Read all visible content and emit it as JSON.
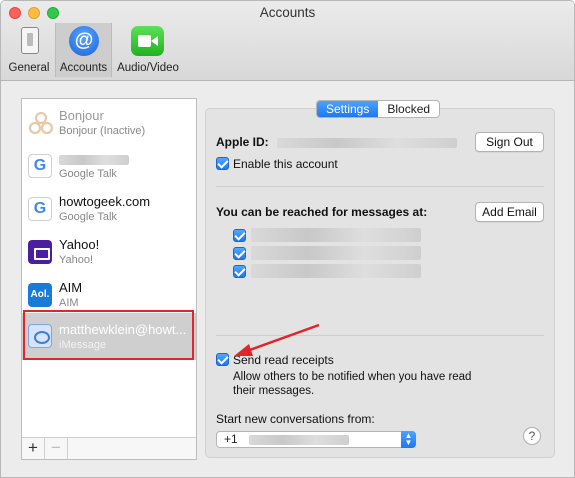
{
  "window": {
    "title": "Accounts"
  },
  "toolbar": {
    "items": [
      {
        "label": "General",
        "icon": "general-switch-icon"
      },
      {
        "label": "Accounts",
        "icon": "at-sign-icon",
        "active": true
      },
      {
        "label": "Audio/Video",
        "icon": "video-camera-icon"
      }
    ]
  },
  "sidebar": {
    "accounts": [
      {
        "name": "Bonjour",
        "subtitle": "Bonjour (Inactive)",
        "icon": "bonjour-icon",
        "inactive": true
      },
      {
        "name": "",
        "subtitle": "Google Talk",
        "icon": "google-icon",
        "name_redacted": true
      },
      {
        "name": "howtogeek.com",
        "subtitle": "Google Talk",
        "icon": "google-icon"
      },
      {
        "name": "Yahoo!",
        "subtitle": "Yahoo!",
        "icon": "yahoo-icon"
      },
      {
        "name": "AIM",
        "subtitle": "AIM",
        "icon": "aim-icon"
      },
      {
        "name": "matthewklein@howt...",
        "subtitle": "iMessage",
        "icon": "imessage-icon",
        "selected": true
      }
    ],
    "add_label": "+",
    "remove_label": "−"
  },
  "tabs": {
    "settings": "Settings",
    "blocked": "Blocked",
    "active": "settings"
  },
  "settings": {
    "apple_id_label": "Apple ID:",
    "sign_out_label": "Sign Out",
    "enable_account_label": "Enable this account",
    "enable_account_checked": true,
    "reach_label": "You can be reached for messages at:",
    "add_email_label": "Add Email",
    "reach_addresses_checked": [
      true,
      true,
      true
    ],
    "read_receipts_label": "Send read receipts",
    "read_receipts_checked": true,
    "read_receipts_help": "Allow others to be notified when you have read their messages.",
    "start_from_label": "Start new conversations from:",
    "start_from_value": "+1",
    "help_label": "?"
  },
  "annotations": {
    "highlight_color": "#e0252b"
  },
  "colors": {
    "accent": "#1d78f2",
    "annotation": "#e0252b"
  }
}
